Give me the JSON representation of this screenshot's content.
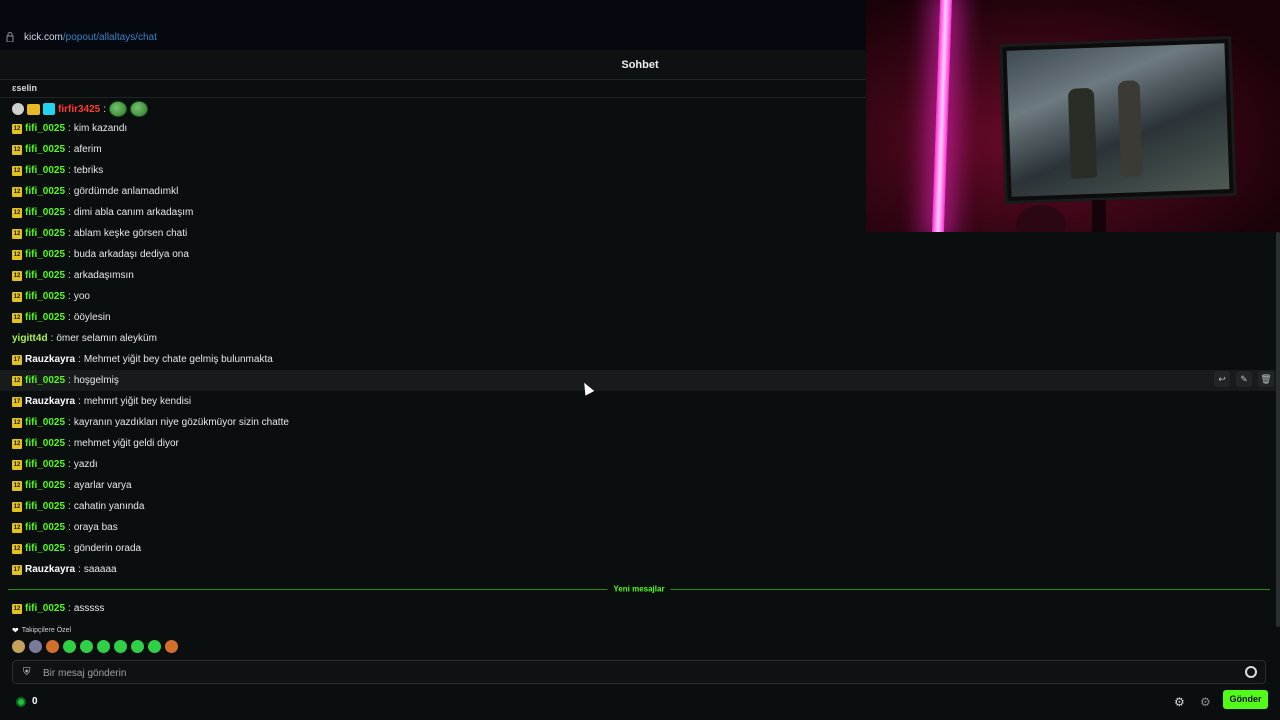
{
  "browser": {
    "url_host": "kick.com",
    "url_path": "/popout/allaltays/chat"
  },
  "header": {
    "title": "Sohbet"
  },
  "pinned": {
    "text": "ɛselin"
  },
  "first_message": {
    "username": "firfir3425",
    "text": ""
  },
  "messages": [
    {
      "badge": "12",
      "username": "fifi_0025",
      "text": "kim kazandı"
    },
    {
      "badge": "12",
      "username": "fifi_0025",
      "text": "aferim"
    },
    {
      "badge": "12",
      "username": "fifi_0025",
      "text": "tebriks"
    },
    {
      "badge": "12",
      "username": "fifi_0025",
      "text": "gördümde anlamadımkl"
    },
    {
      "badge": "12",
      "username": "fifi_0025",
      "text": "dimi abla canım arkadaşım"
    },
    {
      "badge": "12",
      "username": "fifi_0025",
      "text": "ablam keşke görsen chati"
    },
    {
      "badge": "12",
      "username": "fifi_0025",
      "text": "buda arkadaşı dediya ona"
    },
    {
      "badge": "12",
      "username": "fifi_0025",
      "text": "arkadaşımsın"
    },
    {
      "badge": "12",
      "username": "fifi_0025",
      "text": "yoo"
    },
    {
      "badge": "12",
      "username": "fifi_0025",
      "text": "ööylesin"
    },
    {
      "badge": "",
      "username": "yigitt4d",
      "text": "ömer selamın aleyküm"
    },
    {
      "badge": "17",
      "username": "Rauzkayra",
      "text": "Mehmet yiğit bey chate gelmiş bulunmakta"
    },
    {
      "badge": "12",
      "username": "fifi_0025",
      "text": "hoşgelmiş"
    },
    {
      "badge": "17",
      "username": "Rauzkayra",
      "text": "mehmrt yiğit bey kendisi"
    },
    {
      "badge": "12",
      "username": "fifi_0025",
      "text": "kayranın yazdıkları niye gözükmüyor sizin chatte"
    },
    {
      "badge": "12",
      "username": "fifi_0025",
      "text": "mehmet yiğit geldi diyor"
    },
    {
      "badge": "12",
      "username": "fifi_0025",
      "text": "yazdı"
    },
    {
      "badge": "12",
      "username": "fifi_0025",
      "text": "ayarlar varya"
    },
    {
      "badge": "12",
      "username": "fifi_0025",
      "text": "cahatin yanında"
    },
    {
      "badge": "12",
      "username": "fifi_0025",
      "text": "oraya bas"
    },
    {
      "badge": "12",
      "username": "fifi_0025",
      "text": "gönderin orada"
    },
    {
      "badge": "17",
      "username": "Rauzkayra",
      "text": "saaaaa"
    }
  ],
  "new_messages_label": "Yeni mesajlar",
  "last_message": {
    "badge": "12",
    "username": "fifi_0025",
    "text": "asssss"
  },
  "follower_label": "Takipçilere Özel",
  "input": {
    "placeholder": "Bir mesaj gönderin"
  },
  "points": {
    "value": "0"
  },
  "send_label": "Gönder",
  "colors": {
    "accent": "#53fc18",
    "badge": "#e4c21e",
    "name_red": "#ff3b30"
  }
}
